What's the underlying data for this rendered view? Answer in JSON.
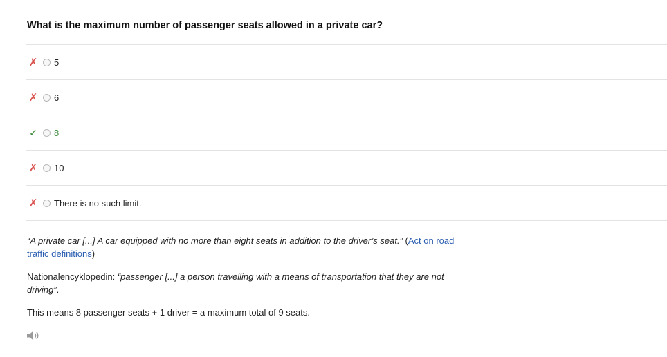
{
  "question": {
    "text": "What is the maximum number of passenger seats allowed in a private car?"
  },
  "answers": [
    {
      "label": "5",
      "status": "wrong",
      "mark": "✗"
    },
    {
      "label": "6",
      "status": "wrong",
      "mark": "✗"
    },
    {
      "label": "8",
      "status": "correct",
      "mark": "✓"
    },
    {
      "label": "10",
      "status": "wrong",
      "mark": "✗"
    },
    {
      "label": "There is no such limit.",
      "status": "wrong",
      "mark": "✗"
    }
  ],
  "explanation": {
    "p1_quote": "“A private car [...] A car equipped with no more than eight seats in addition to the driver’s seat.”",
    "p1_paren_open": " (",
    "p1_link": "Act on road traffic definitions",
    "p1_paren_close": ")",
    "p2_source": "Nationalencyklopedin: ",
    "p2_quote": "“passenger [...] a person travelling with a means of transportation that they are not driving”",
    "p2_end": ".",
    "p3": "This means 8 passenger seats + 1 driver = a maximum total of 9 seats."
  },
  "audio": {
    "icon": "speaker-icon"
  },
  "colors": {
    "wrong_mark": "#d9534f",
    "correct_mark": "#3c8a3c",
    "link": "#2a5db0",
    "divider": "#e3e3e3"
  }
}
